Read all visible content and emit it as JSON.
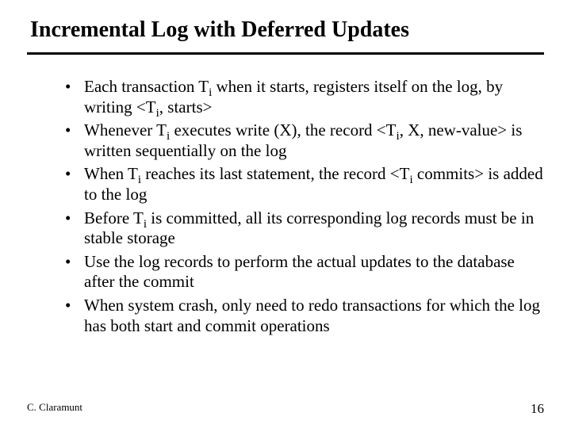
{
  "title": "Incremental Log with Deferred Updates",
  "bullets": [
    {
      "pre": "Each transaction T",
      "sub1": "i",
      "mid1": " when it starts, registers itself on the log, by writing <T",
      "sub2": "i",
      "mid2": ", starts>",
      "sub3": "",
      "tail": ""
    },
    {
      "pre": "Whenever T",
      "sub1": "i",
      "mid1": " executes write (X), the record <T",
      "sub2": "i",
      "mid2": ", X, new-value> is written sequentially on the log",
      "sub3": "",
      "tail": ""
    },
    {
      "pre": "When T",
      "sub1": "i",
      "mid1": " reaches its last statement, the record <T",
      "sub2": "i",
      "mid2": " commits> is added to the log",
      "sub3": "",
      "tail": ""
    },
    {
      "pre": "Before T",
      "sub1": "i",
      "mid1": " is committed, all its corresponding log records must be in stable storage",
      "sub2": "",
      "mid2": "",
      "sub3": "",
      "tail": ""
    },
    {
      "pre": "Use the log records to perform the actual updates to the database after the commit",
      "sub1": "",
      "mid1": "",
      "sub2": "",
      "mid2": "",
      "sub3": "",
      "tail": ""
    },
    {
      "pre": "When system crash, only need to redo transactions for which the log has both start and commit operations",
      "sub1": "",
      "mid1": "",
      "sub2": "",
      "mid2": "",
      "sub3": "",
      "tail": ""
    }
  ],
  "footer": {
    "author": "C. Claramunt",
    "page": "16"
  }
}
